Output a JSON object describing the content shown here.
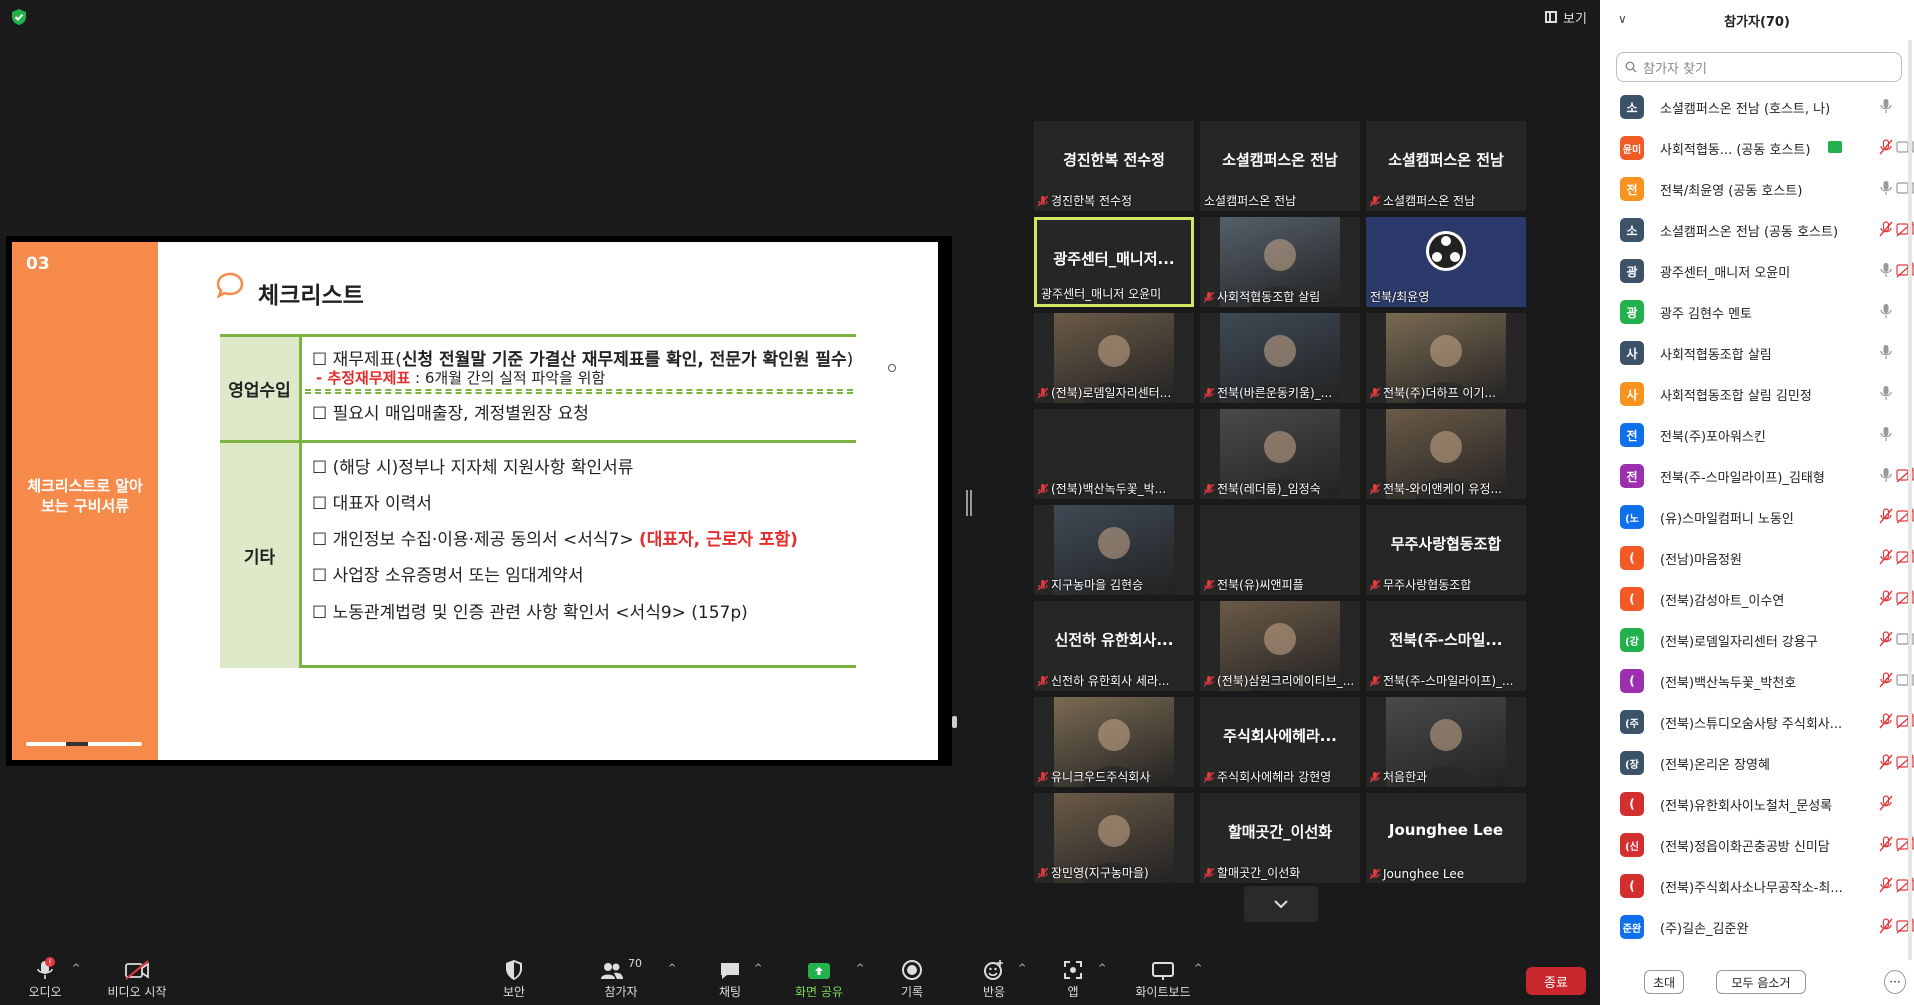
{
  "colors": {
    "background": "#1a1a1a",
    "tile": "#262626",
    "slide_accent": "#f58a4b",
    "table_green": "#7cb342",
    "active_speaker": "#d5e664",
    "end_button": "#c8282d",
    "mic_off": "#e0393e",
    "share_green": "#22b14c"
  },
  "top": {
    "view_label": "보기"
  },
  "slide": {
    "number": "03",
    "side_text": "체크리스트로 알아보는 구비서류",
    "title": "체크리스트",
    "cat_revenue": "영업수입",
    "cat_other": "기타",
    "line1_pre": "☐ 재무제표(",
    "line1_bold": "신청 전월말 기준 가결산 재무제표를 확인, 전문가 확인원 필수",
    "line1_post": ")",
    "line2_pre": "- ",
    "line2_red": "추정재무제표",
    "line2_post": " : 6개월 간의 실적 파악을 위함",
    "line3": "☐ 필요시 매입매출장, 계정별원장 요청",
    "line4": "☐ (해당 시)정부나 지자체 지원사항 확인서류",
    "line5": "☐ 대표자 이력서",
    "line6_pre": "☐ 개인정보 수집·이용·제공 동의서 <서식7> ",
    "line6_red": "(대표자, 근로자 포함)",
    "line7": "☐ 사업장 소유증명서 또는 임대계약서",
    "line8": "☐ 노동관계법령 및 인증 관련 사항 확인서 <서식9> (157p)"
  },
  "gallery": [
    {
      "big": "경진한복 전수정",
      "name": "경진한복 전수정",
      "muted": true,
      "video": false
    },
    {
      "big": "소셜캠퍼스온 전남",
      "name": "소셜캠퍼스온 전남",
      "muted": false,
      "video": false
    },
    {
      "big": "소셜캠퍼스온 전남",
      "name": "소셜캠퍼스온 전남",
      "muted": true,
      "video": false
    },
    {
      "big": "광주센터_매니저...",
      "name": "광주센터_매니저 오윤미",
      "muted": false,
      "video": false,
      "active": true
    },
    {
      "big": "",
      "name": "사회적협동조합 살림",
      "muted": true,
      "video": true
    },
    {
      "big": "",
      "name": "전북/최윤영",
      "muted": false,
      "video": true,
      "logo": true
    },
    {
      "big": "",
      "name": "(전북)로뎀일자리센터...",
      "muted": true,
      "video": true
    },
    {
      "big": "",
      "name": "전북(바른운동키움)_...",
      "muted": true,
      "video": true
    },
    {
      "big": "",
      "name": "전북(주)더하프 이기...",
      "muted": true,
      "video": true
    },
    {
      "big": "",
      "name": "(전북)백산녹두꽃_박...",
      "muted": true,
      "video": false
    },
    {
      "big": "",
      "name": "전북(레더룸)_임정숙",
      "muted": true,
      "video": true
    },
    {
      "big": "",
      "name": "전북-와이앤케이 유정...",
      "muted": true,
      "video": true
    },
    {
      "big": "",
      "name": "지구농마을 김현승",
      "muted": true,
      "video": true
    },
    {
      "big": "",
      "name": "전북(유)씨앤피플",
      "muted": true,
      "video": false
    },
    {
      "big": "무주사랑협동조합",
      "name": "무주사랑협동조합",
      "muted": true,
      "video": false
    },
    {
      "big": "신전하 유한회사...",
      "name": "신전하 유한회사 세라...",
      "muted": true,
      "video": false
    },
    {
      "big": "",
      "name": "(전북)삼원크리에이티브_...",
      "muted": true,
      "video": true
    },
    {
      "big": "전북(주-스마일...",
      "name": "전북(주-스마일라이프)_...",
      "muted": true,
      "video": false
    },
    {
      "big": "",
      "name": "유니크우드주식회사",
      "muted": true,
      "video": true
    },
    {
      "big": "주식회사에헤라...",
      "name": "주식회사에헤라 강현영",
      "muted": true,
      "video": false
    },
    {
      "big": "",
      "name": "처음한과",
      "muted": true,
      "video": true
    },
    {
      "big": "",
      "name": "장민영(지구농마을)",
      "muted": true,
      "video": true
    },
    {
      "big": "할매곳간_이선화",
      "name": "할매곳간_이선화",
      "muted": true,
      "video": false
    },
    {
      "big": "Jounghee Lee",
      "name": "Jounghee Lee",
      "muted": true,
      "video": false
    }
  ],
  "toolbar": {
    "audio": "오디오",
    "video": "비디오 시작",
    "security": "보안",
    "participants": "참가자",
    "participants_count": "70",
    "chat": "채팅",
    "share": "화면 공유",
    "record": "기록",
    "reactions": "반응",
    "apps": "앱",
    "whiteboard": "화이트보드",
    "end": "종료"
  },
  "panel": {
    "title": "참가자(70)",
    "search_placeholder": "참가자 찾기",
    "invite": "초대",
    "mute_all": "모두 음소거",
    "more": "···",
    "participants": [
      {
        "avatar": "소",
        "color": "#3b5268",
        "name": "소셜캠퍼스온 전남 (호스트, 나)",
        "mic": "on",
        "cam": "none"
      },
      {
        "avatar": "윤미",
        "color": "#f15a24",
        "name": "사회적협동...  (공동 호스트)",
        "mic": "off",
        "cam": "on",
        "share": true
      },
      {
        "avatar": "전",
        "color": "#f7931e",
        "name": "전북/최윤영 (공동 호스트)",
        "mic": "on",
        "cam": "on"
      },
      {
        "avatar": "소",
        "color": "#3b5268",
        "name": "소셜캠퍼스온 전남 (공동 호스트)",
        "mic": "off",
        "cam": "off"
      },
      {
        "avatar": "광",
        "color": "#3b5268",
        "name": "광주센터_매니저 오윤미",
        "mic": "on",
        "cam": "off"
      },
      {
        "avatar": "광",
        "color": "#22b14c",
        "name": "광주 김현수 멘토",
        "mic": "on",
        "cam": "none"
      },
      {
        "avatar": "사",
        "color": "#3b5268",
        "name": "사회적협동조합 살림",
        "mic": "on",
        "cam": "none"
      },
      {
        "avatar": "사",
        "color": "#f7931e",
        "name": "사회적협동조합 살림 김민정",
        "mic": "on",
        "cam": "none"
      },
      {
        "avatar": "전",
        "color": "#0e71eb",
        "name": "전북(주)포아워스킨",
        "mic": "on",
        "cam": "none"
      },
      {
        "avatar": "전",
        "color": "#9b2fae",
        "name": "전북(주-스마일라이프)_김태형",
        "mic": "on",
        "cam": "off"
      },
      {
        "avatar": "(노",
        "color": "#0e71eb",
        "name": "(유)스마일컴퍼니 노동인",
        "mic": "off",
        "cam": "off"
      },
      {
        "avatar": "(",
        "color": "#f15a24",
        "name": "(전남)마음정원",
        "mic": "off",
        "cam": "off"
      },
      {
        "avatar": "(",
        "color": "#f15a24",
        "name": "(전북)감성아트_이수연",
        "mic": "off",
        "cam": "off"
      },
      {
        "avatar": "(강",
        "color": "#22b14c",
        "name": "(전북)로뎀일자리센터 강용구",
        "mic": "off",
        "cam": "on"
      },
      {
        "avatar": "(",
        "color": "#9b2fae",
        "name": "(전북)백산녹두꽃_박천호",
        "mic": "off",
        "cam": "on"
      },
      {
        "avatar": "(주",
        "color": "#3b5268",
        "name": "(전북)스튜디오숨사탕 주식회사...",
        "mic": "off",
        "cam": "off"
      },
      {
        "avatar": "(장",
        "color": "#3b5268",
        "name": "(전북)온리온 장영혜",
        "mic": "off",
        "cam": "off"
      },
      {
        "avatar": "(",
        "color": "#d32f2f",
        "name": "(전북)유한회사이노철처_문성록",
        "mic": "off",
        "cam": "none"
      },
      {
        "avatar": "(신",
        "color": "#d32f2f",
        "name": "(전북)정읍이화곤충공방 신미담",
        "mic": "off",
        "cam": "off"
      },
      {
        "avatar": "(",
        "color": "#d32f2f",
        "name": "(전북)주식회사소나무공작소-최...",
        "mic": "off",
        "cam": "off"
      },
      {
        "avatar": "준완",
        "color": "#0e71eb",
        "name": "(주)길손_김준완",
        "mic": "off",
        "cam": "off"
      }
    ]
  }
}
